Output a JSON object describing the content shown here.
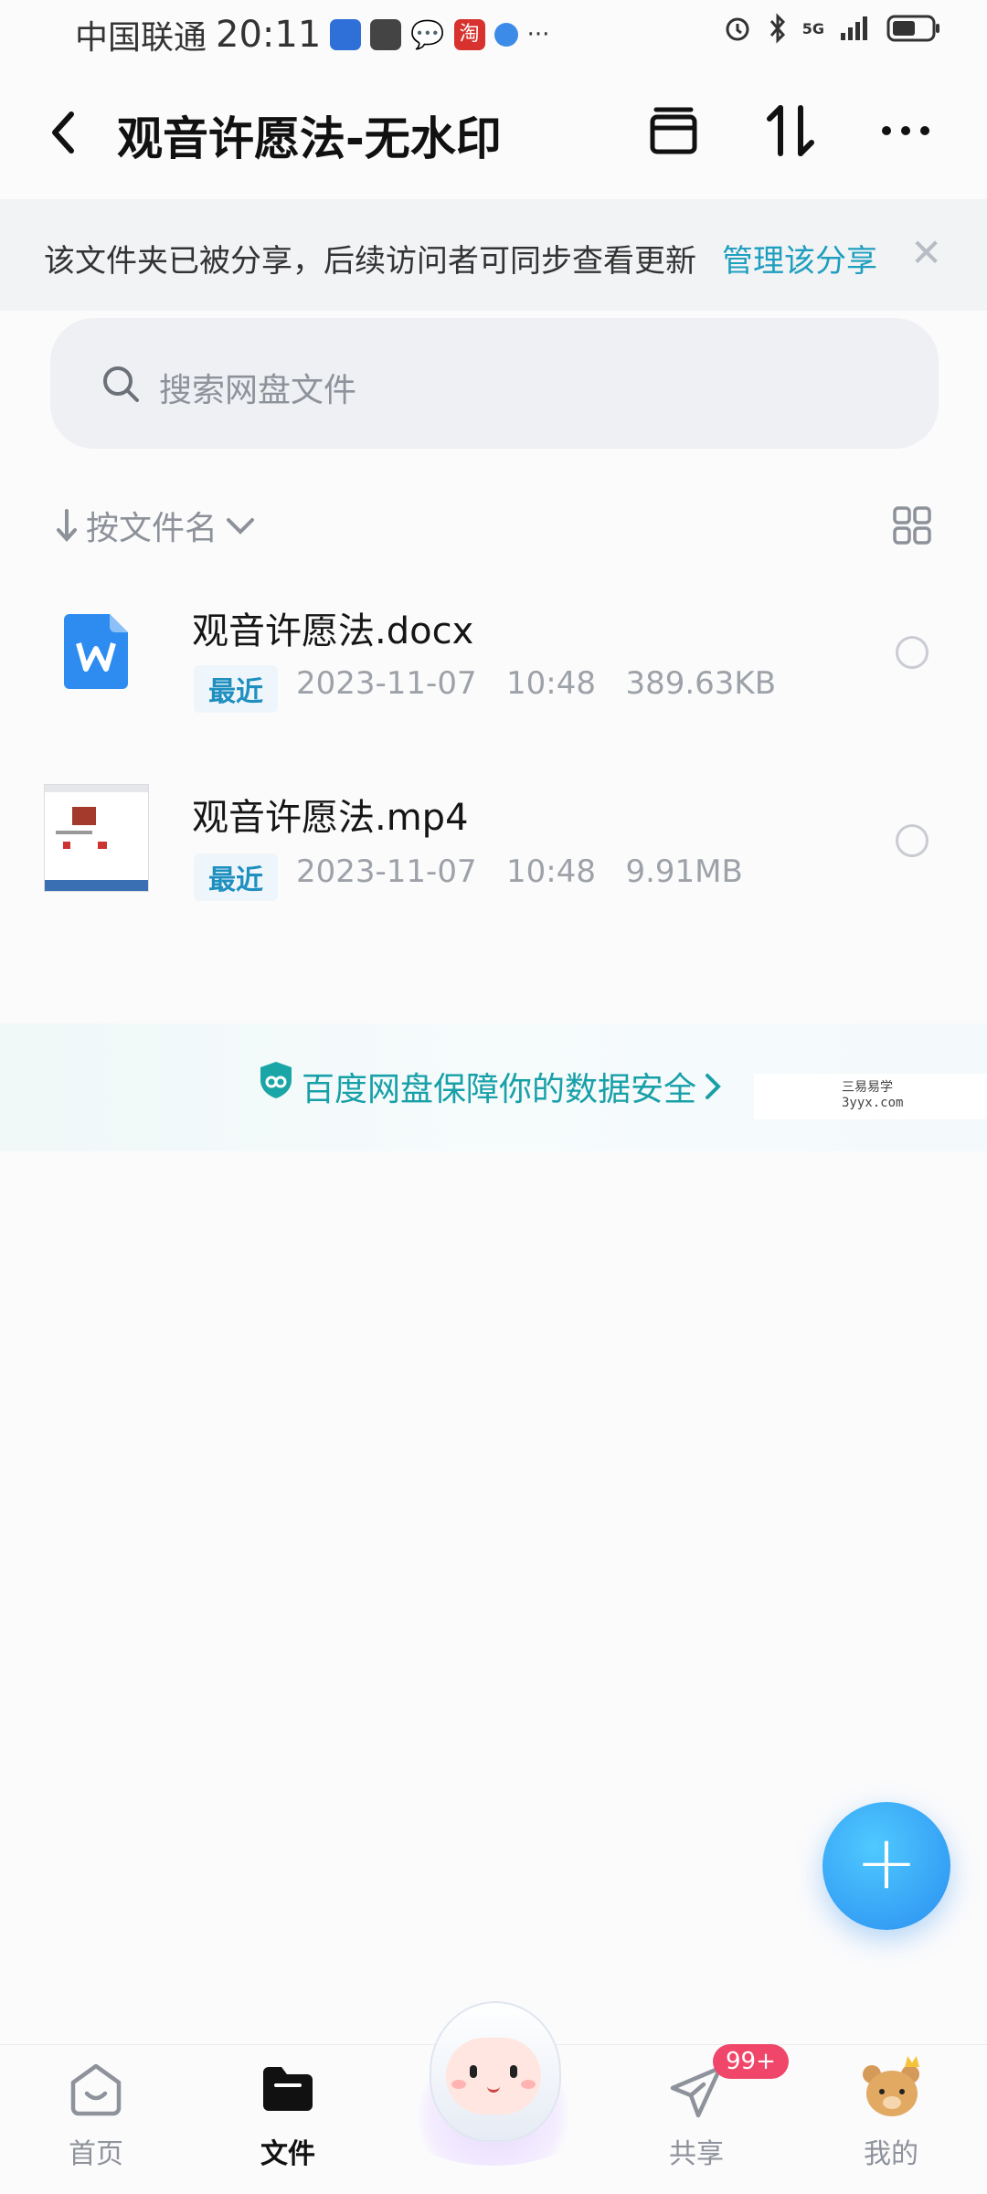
{
  "status_bar": {
    "carrier": "中国联通",
    "time": "20:11",
    "more": "···",
    "signal_label": "5G"
  },
  "header": {
    "title": "观音许愿法-无水印",
    "icons": [
      "back-icon",
      "select-box-icon",
      "sort-transfer-icon",
      "more-icon"
    ]
  },
  "share_banner": {
    "text": "该文件夹已被分享，后续访问者可同步查看更新",
    "link": "管理该分享",
    "close": "✕"
  },
  "search": {
    "placeholder": "搜索网盘文件"
  },
  "sort": {
    "label": "按文件名"
  },
  "files": [
    {
      "name": "观音许愿法.docx",
      "tag": "最近",
      "date": "2023-11-07",
      "time": "10:48",
      "size": "389.63KB",
      "icon": "word-doc-icon"
    },
    {
      "name": "观音许愿法.mp4",
      "tag": "最近",
      "date": "2023-11-07",
      "time": "10:48",
      "size": "9.91MB",
      "icon": "video-thumbnail"
    }
  ],
  "safety": {
    "text": "百度网盘保障你的数据安全"
  },
  "watermark": {
    "line1": "三易易学",
    "line2": "3yyx.com"
  },
  "fab": {
    "label": "+"
  },
  "nav": {
    "items": [
      {
        "label": "首页",
        "icon": "home-icon"
      },
      {
        "label": "文件",
        "icon": "folder-icon",
        "active": true
      },
      {
        "label": "",
        "icon": "mascot-icon"
      },
      {
        "label": "共享",
        "icon": "paper-plane-icon",
        "badge": "99+"
      },
      {
        "label": "我的",
        "icon": "bear-avatar-icon"
      }
    ]
  },
  "colors": {
    "accent": "#1f9fbf",
    "badge": "#f0466a",
    "fab": "#2a8ff0"
  }
}
